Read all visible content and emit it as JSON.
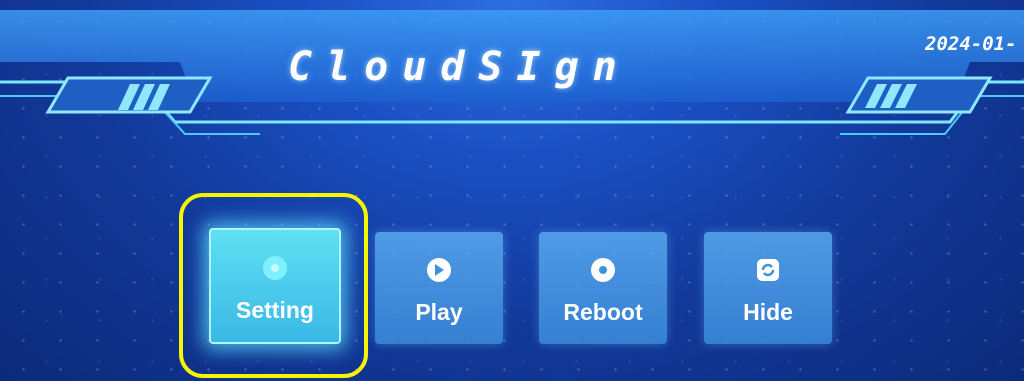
{
  "header": {
    "logo": "CloudSIgn",
    "clock": "2024-01-"
  },
  "menu": [
    {
      "label": "Setting",
      "icon": "gear-icon",
      "active": true
    },
    {
      "label": "Play",
      "icon": "play-icon",
      "active": false
    },
    {
      "label": "Reboot",
      "icon": "reboot-icon",
      "active": false
    },
    {
      "label": "Hide",
      "icon": "hide-icon",
      "active": false
    }
  ],
  "colors": {
    "highlight": "#f5f500",
    "accent": "#5fe0f2",
    "tile": "#4a9ee6"
  }
}
